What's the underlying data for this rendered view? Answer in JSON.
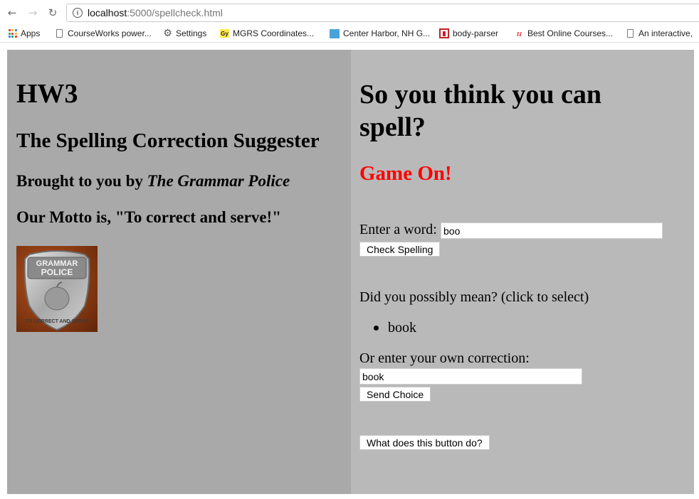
{
  "browser": {
    "url_host": "localhost",
    "url_rest": ":5000/spellcheck.html",
    "bookmarks": [
      {
        "label": "Apps",
        "icon": "apps-grid-icon"
      },
      {
        "label": "CourseWorks power...",
        "icon": "document-icon"
      },
      {
        "label": "Settings",
        "icon": "gear-icon"
      },
      {
        "label": "MGRS Coordinates...",
        "icon": "gy-icon"
      },
      {
        "label": "Center Harbor, NH G...",
        "icon": "map-icon"
      },
      {
        "label": "body-parser",
        "icon": "npm-icon"
      },
      {
        "label": "Best Online Courses...",
        "icon": "udemy-icon"
      },
      {
        "label": "An interactive,",
        "icon": "document-icon"
      }
    ]
  },
  "left": {
    "title": "HW3",
    "subtitle": "The Spelling Correction Suggester",
    "brought_prefix": "Brought to you by ",
    "brought_name": "The Grammar Police",
    "motto": "Our Motto is, \"To correct and serve!\"",
    "badge": {
      "top_text": "GRAMMAR",
      "middle_text": "POLICE",
      "bottom_text": "TO CORRECT AND SERVE"
    }
  },
  "right": {
    "heading": "So you think you can spell?",
    "game_on": "Game On!",
    "enter_label": "Enter a word:",
    "word_value": "boo",
    "check_button": "Check Spelling",
    "suggest_prompt": "Did you possibly mean? (click to select)",
    "suggestions": [
      "book"
    ],
    "own_label": "Or enter your own correction:",
    "own_value": "book",
    "send_button": "Send Choice",
    "mystery_button": "What does this button do?"
  },
  "colors": {
    "left_bg": "#a9a9a9",
    "right_bg": "#b9b9b9",
    "game_on": "#ff0000"
  }
}
